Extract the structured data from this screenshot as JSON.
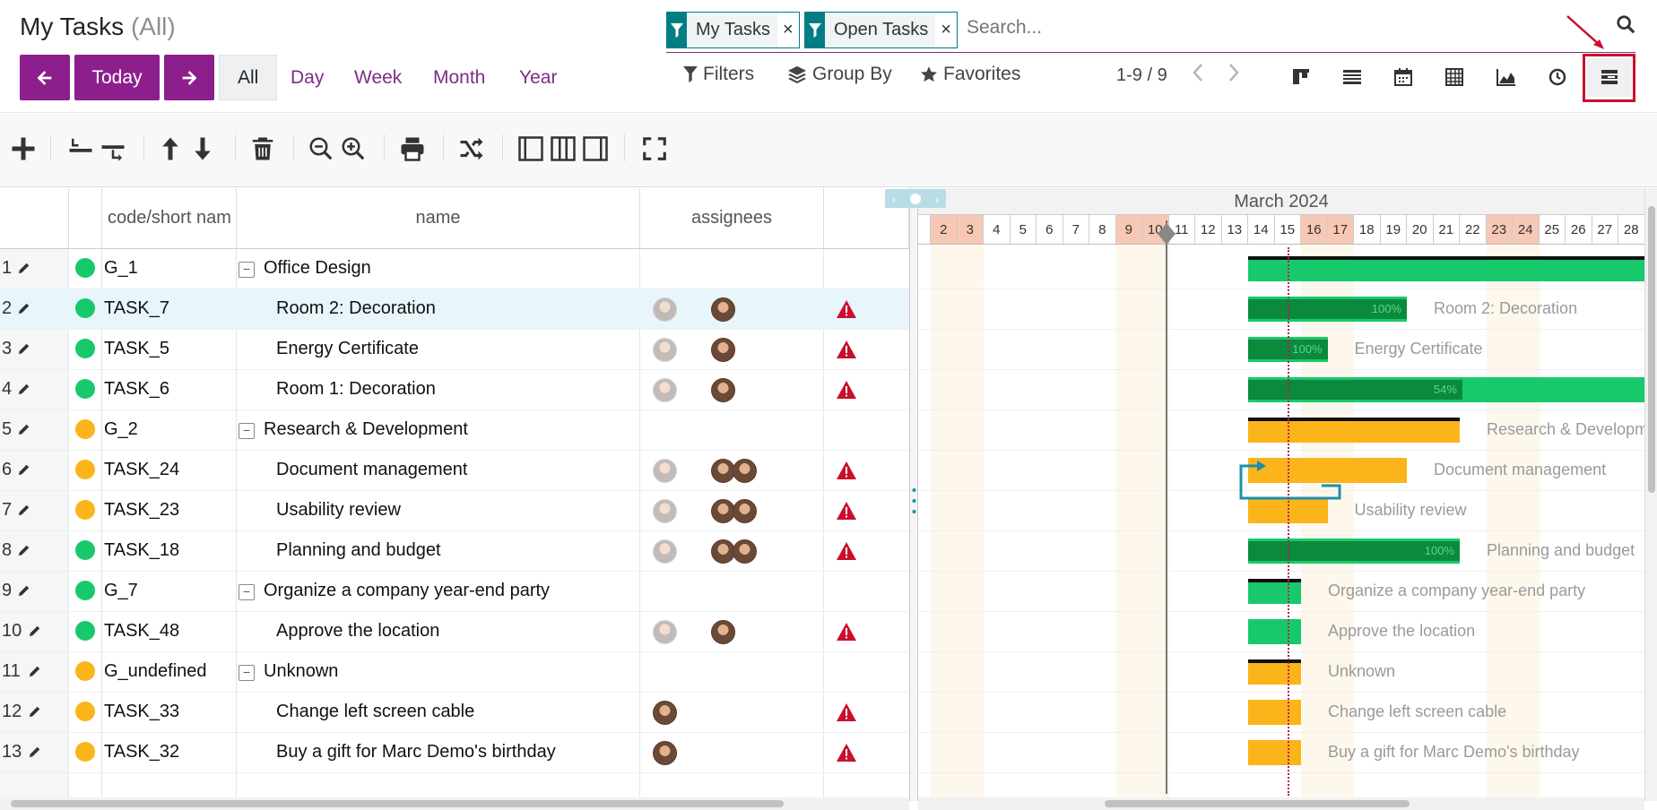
{
  "header": {
    "title": "My Tasks",
    "title_suffix": "(All)",
    "nav": {
      "prev_icon": "arrow-left",
      "today_label": "Today",
      "next_icon": "arrow-right"
    },
    "scales": [
      "All",
      "Day",
      "Week",
      "Month",
      "Year"
    ],
    "active_scale": "All",
    "facets": [
      {
        "label": "My Tasks"
      },
      {
        "label": "Open Tasks"
      }
    ],
    "facet_remove": "×",
    "search_placeholder": "Search...",
    "filters_label": "Filters",
    "groupby_label": "Group By",
    "favorites_label": "Favorites",
    "pager": "1-9 / 9",
    "views": [
      "kanban",
      "list",
      "calendar",
      "pivot",
      "graph",
      "activity",
      "gantt"
    ],
    "accent": "#7d2d86",
    "highlight_color": "#c8102e"
  },
  "toolbar": [
    "add-icon",
    "collapse-all-icon",
    "expand-all-icon",
    "move-up-icon",
    "move-down-icon",
    "delete-icon",
    "zoom-out-icon",
    "zoom-in-icon",
    "print-icon",
    "critical-path-icon",
    "grid-only-icon",
    "both-panes-icon",
    "chart-only-icon",
    "fullscreen-icon"
  ],
  "grid": {
    "columns": [
      "code/short nam",
      "name",
      "assignees",
      ""
    ],
    "rows": [
      {
        "n": "1",
        "code": "G_1",
        "name": "Office Design",
        "group": true,
        "status": "green",
        "grey": 0,
        "dark": 0,
        "warn": false
      },
      {
        "n": "2",
        "code": "TASK_7",
        "name": "Room 2: Decoration",
        "group": false,
        "status": "green",
        "grey": 1,
        "dark": 1,
        "warn": true,
        "selected": true
      },
      {
        "n": "3",
        "code": "TASK_5",
        "name": "Energy Certificate",
        "group": false,
        "status": "green",
        "grey": 1,
        "dark": 1,
        "warn": true
      },
      {
        "n": "4",
        "code": "TASK_6",
        "name": "Room 1: Decoration",
        "group": false,
        "status": "green",
        "grey": 1,
        "dark": 1,
        "warn": true
      },
      {
        "n": "5",
        "code": "G_2",
        "name": "Research & Development",
        "group": true,
        "status": "orange",
        "grey": 0,
        "dark": 0,
        "warn": false
      },
      {
        "n": "6",
        "code": "TASK_24",
        "name": "Document management",
        "group": false,
        "status": "orange",
        "grey": 1,
        "dark": 2,
        "warn": true
      },
      {
        "n": "7",
        "code": "TASK_23",
        "name": "Usability review",
        "group": false,
        "status": "orange",
        "grey": 1,
        "dark": 2,
        "warn": true
      },
      {
        "n": "8",
        "code": "TASK_18",
        "name": "Planning and budget",
        "group": false,
        "status": "green",
        "grey": 1,
        "dark": 2,
        "warn": true
      },
      {
        "n": "9",
        "code": "G_7",
        "name": "Organize a company year-end party",
        "group": true,
        "status": "green",
        "grey": 0,
        "dark": 0,
        "warn": false
      },
      {
        "n": "10",
        "code": "TASK_48",
        "name": "Approve the location",
        "group": false,
        "status": "green",
        "grey": 1,
        "dark": 1,
        "warn": true
      },
      {
        "n": "11",
        "code": "G_undefined",
        "name": "Unknown",
        "group": true,
        "status": "orange",
        "grey": 0,
        "dark": 0,
        "warn": false
      },
      {
        "n": "12",
        "code": "TASK_33",
        "name": "Change left screen cable",
        "group": false,
        "status": "orange",
        "grey": 0,
        "dark": 1,
        "dark_first": true,
        "warn": true
      },
      {
        "n": "13",
        "code": "TASK_32",
        "name": "Buy a gift for Marc Demo's birthday",
        "group": false,
        "status": "orange",
        "grey": 0,
        "dark": 1,
        "dark_first": true,
        "warn": true
      }
    ]
  },
  "gantt": {
    "month_label": "March 2024",
    "days": [
      "2",
      "3",
      "4",
      "5",
      "6",
      "7",
      "8",
      "9",
      "10",
      "11",
      "12",
      "13",
      "14",
      "15",
      "16",
      "17",
      "18",
      "19",
      "20",
      "21",
      "22",
      "23",
      "24",
      "25",
      "26",
      "27",
      "28"
    ],
    "weekend_days": [
      "2",
      "3",
      "9",
      "10",
      "16",
      "17",
      "23",
      "24"
    ],
    "bars": [
      {
        "row": 0,
        "start": 14,
        "end": 28,
        "color": "green",
        "summary": true,
        "label": ""
      },
      {
        "row": 1,
        "start": 14,
        "end": 19,
        "color": "green",
        "progress": 100,
        "progress_text": "100%",
        "label": "Room 2: Decoration"
      },
      {
        "row": 2,
        "start": 14,
        "end": 16,
        "color": "green",
        "progress": 100,
        "progress_text": "100%",
        "label": "Energy Certificate"
      },
      {
        "row": 3,
        "start": 14,
        "end": 28,
        "color": "green",
        "progress": 54,
        "progress_text": "54%",
        "label": ""
      },
      {
        "row": 4,
        "start": 14,
        "end": 21,
        "color": "orange",
        "summary": true,
        "label": "Research & Development"
      },
      {
        "row": 5,
        "start": 14,
        "end": 19,
        "color": "orange",
        "label": "Document management"
      },
      {
        "row": 6,
        "start": 14,
        "end": 16,
        "color": "orange",
        "label": "Usability review"
      },
      {
        "row": 7,
        "start": 14,
        "end": 21,
        "color": "green",
        "progress": 100,
        "progress_text": "100%",
        "label": "Planning and budget"
      },
      {
        "row": 8,
        "start": 14,
        "end": 15,
        "color": "green",
        "summary": true,
        "label": "Organize a company year-end party"
      },
      {
        "row": 9,
        "start": 14,
        "end": 15,
        "color": "green",
        "label": "Approve the location"
      },
      {
        "row": 10,
        "start": 14,
        "end": 15,
        "color": "orange",
        "summary": true,
        "label": "Unknown"
      },
      {
        "row": 11,
        "start": 14,
        "end": 15,
        "color": "orange",
        "label": "Change left screen cable"
      },
      {
        "row": 12,
        "start": 14,
        "end": 15,
        "color": "orange",
        "label": "Buy a gift for Marc Demo's birthday"
      }
    ],
    "colors": {
      "green": "#18c96b",
      "orange": "#fbb41a",
      "link": "#1e8fa8"
    }
  }
}
